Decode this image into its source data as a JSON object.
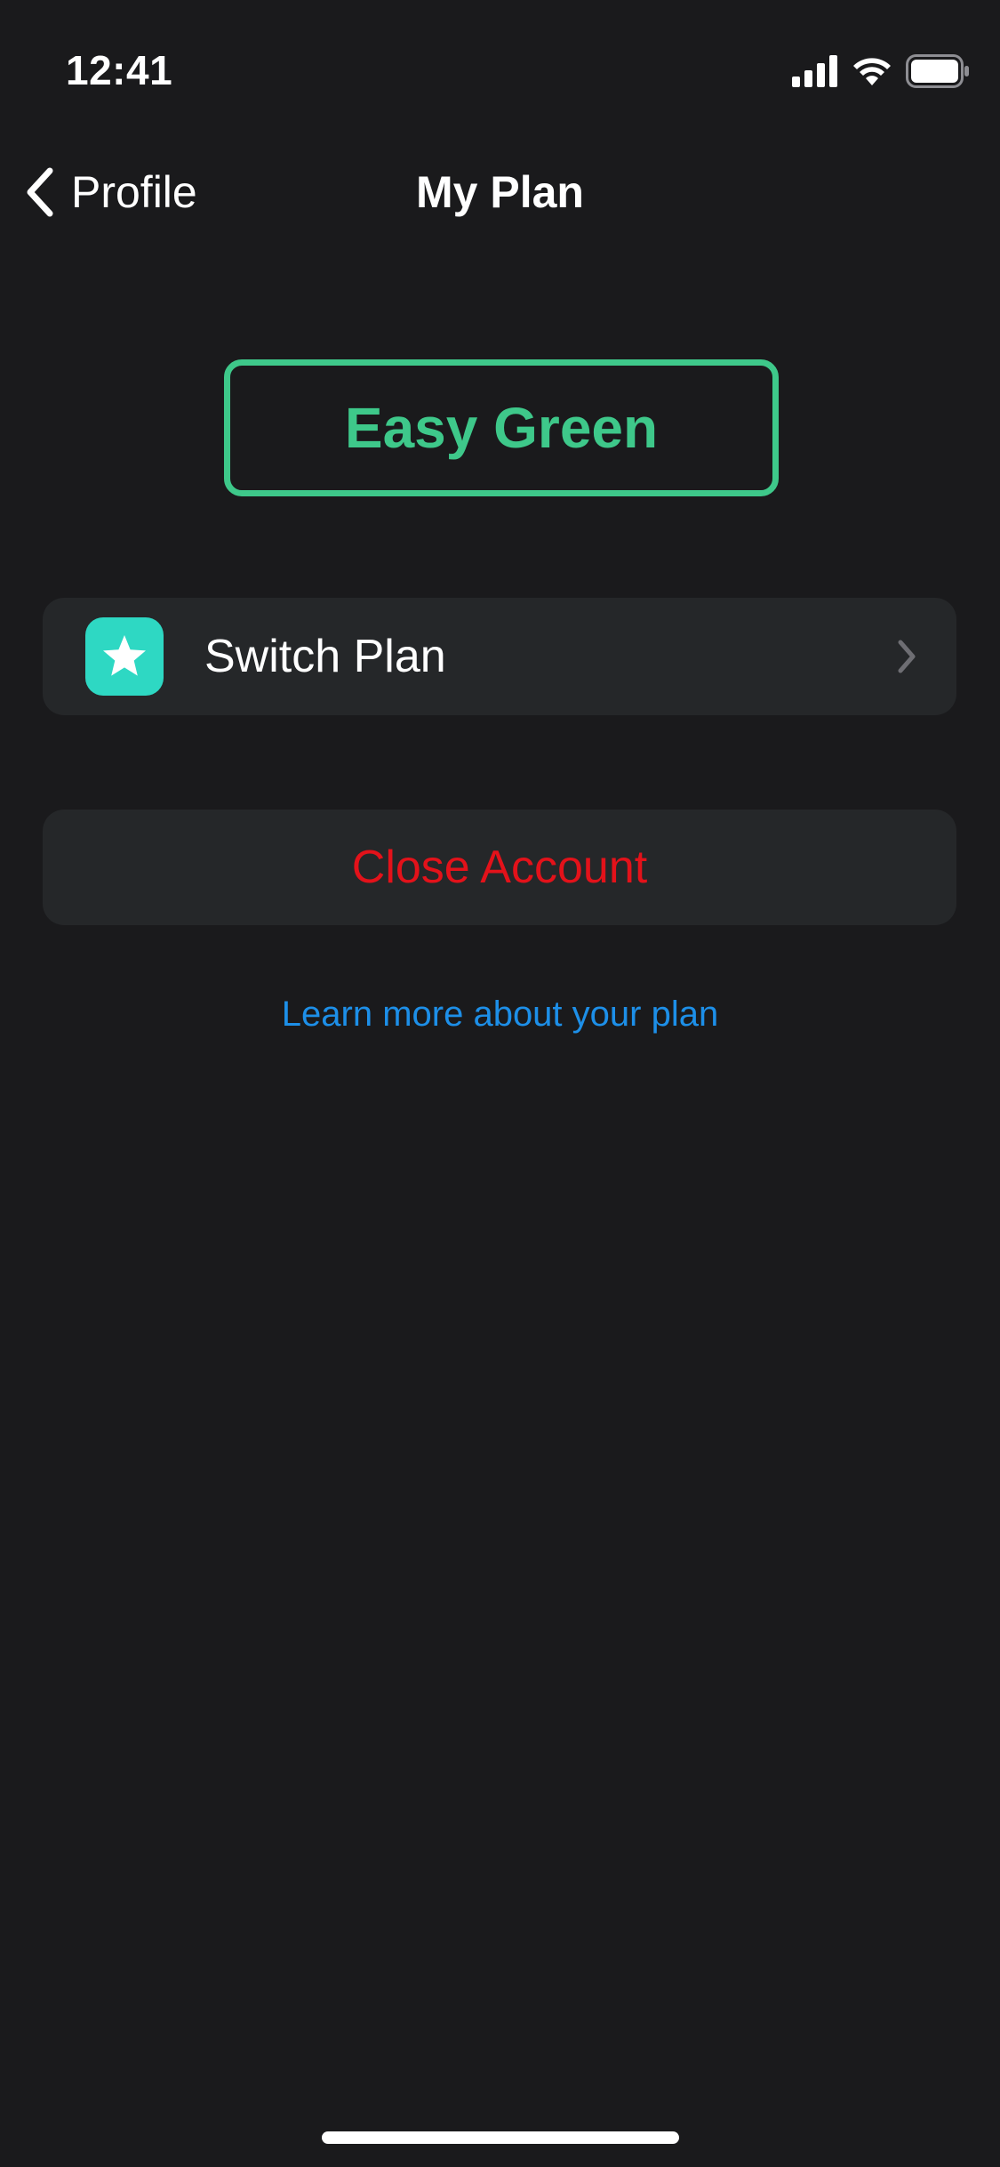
{
  "status_bar": {
    "time": "12:41"
  },
  "nav": {
    "back_label": "Profile",
    "title": "My Plan"
  },
  "plan": {
    "name": "Easy Green"
  },
  "switch_plan": {
    "label": "Switch Plan",
    "icon": "star-icon"
  },
  "close_account": {
    "label": "Close Account"
  },
  "learn_more": {
    "label": "Learn more about your plan"
  },
  "colors": {
    "background": "#1a1a1c",
    "card": "#252729",
    "plan_accent": "#3ec88a",
    "star_tile": "#2ed8c3",
    "danger": "#e3121a",
    "link": "#1d8fe8"
  }
}
